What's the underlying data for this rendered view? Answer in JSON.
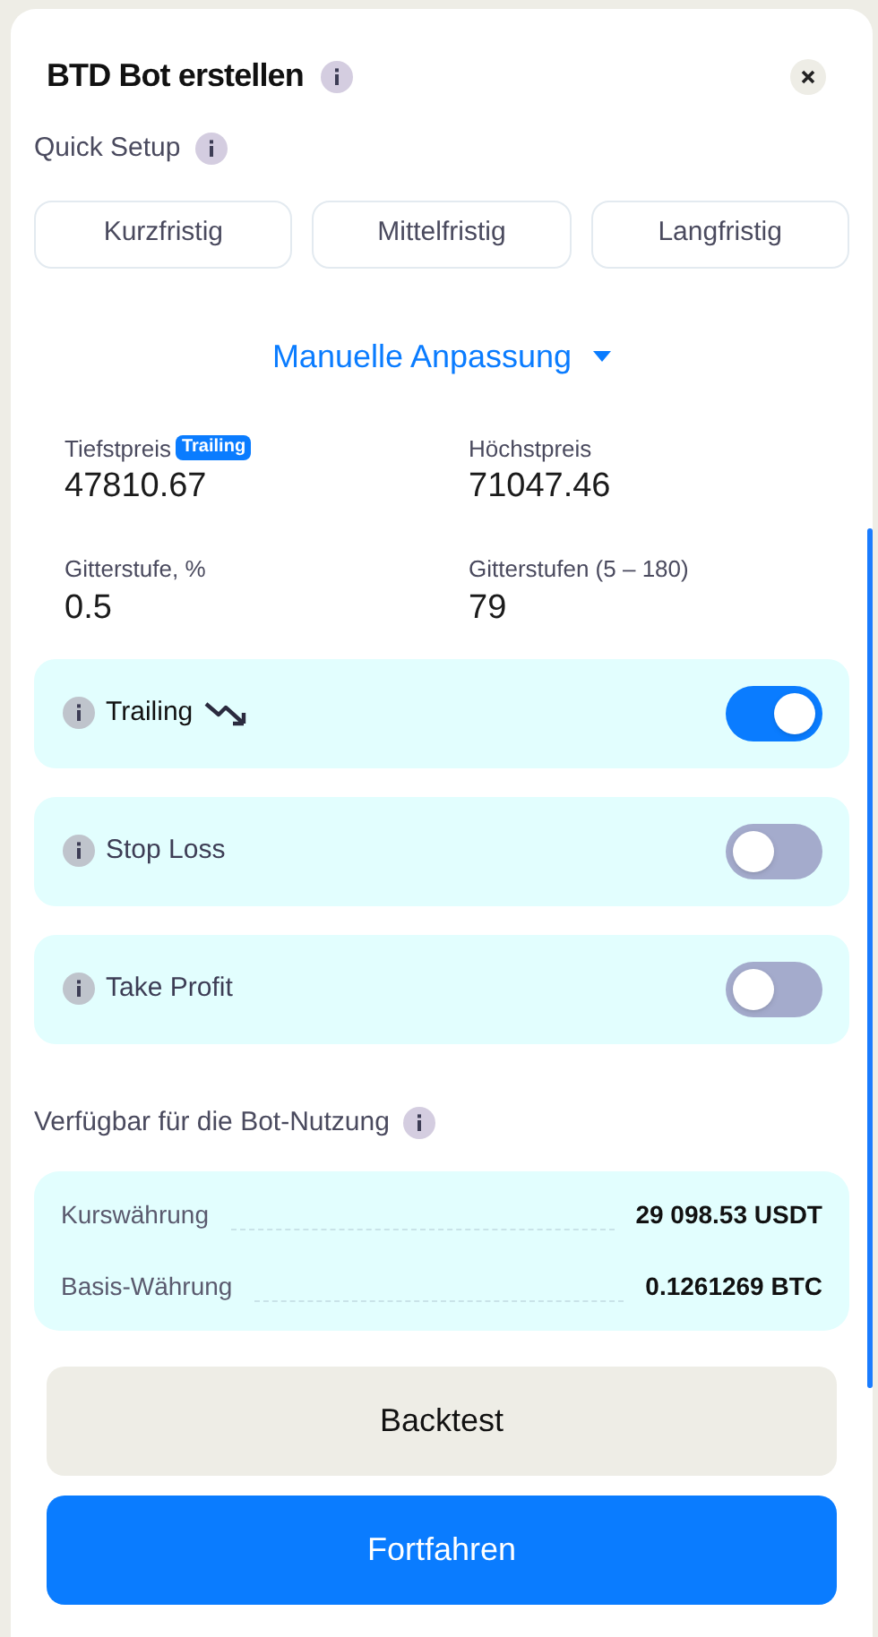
{
  "dialog": {
    "title": "BTD Bot erstellen"
  },
  "quick_setup": {
    "label": "Quick Setup",
    "presets": [
      {
        "label": "Kurzfristig",
        "selected": false
      },
      {
        "label": "Mittelfristig",
        "selected": false
      },
      {
        "label": "Langfristig",
        "selected": false
      }
    ]
  },
  "manual": {
    "label": "Manuelle Anpassung",
    "expanded": true
  },
  "fields": [
    {
      "label": "Tiefstpreis",
      "badge": "Trailing",
      "value": "47810.67"
    },
    {
      "label": "Höchstpreis",
      "value": "71047.46"
    },
    {
      "label": "Gitterstufe, %",
      "value": "0.5"
    },
    {
      "label": "Gitterstufen (5 – 180)",
      "value": "79"
    }
  ],
  "options": [
    {
      "label": "Trailing",
      "on": true,
      "trend_icon": true
    },
    {
      "label": "Stop Loss",
      "on": false
    },
    {
      "label": "Take Profit",
      "on": false
    }
  ],
  "available": {
    "label": "Verfügbar für die Bot-Nutzung",
    "rows": [
      {
        "label": "Kurswährung",
        "value": "29 098.53 USDT"
      },
      {
        "label": "Basis-Währung",
        "value": "0.1261269 BTC"
      }
    ]
  },
  "buttons": [
    {
      "label": "Backtest",
      "kind": "secondary"
    },
    {
      "label": "Fortfahren",
      "kind": "primary"
    }
  ]
}
